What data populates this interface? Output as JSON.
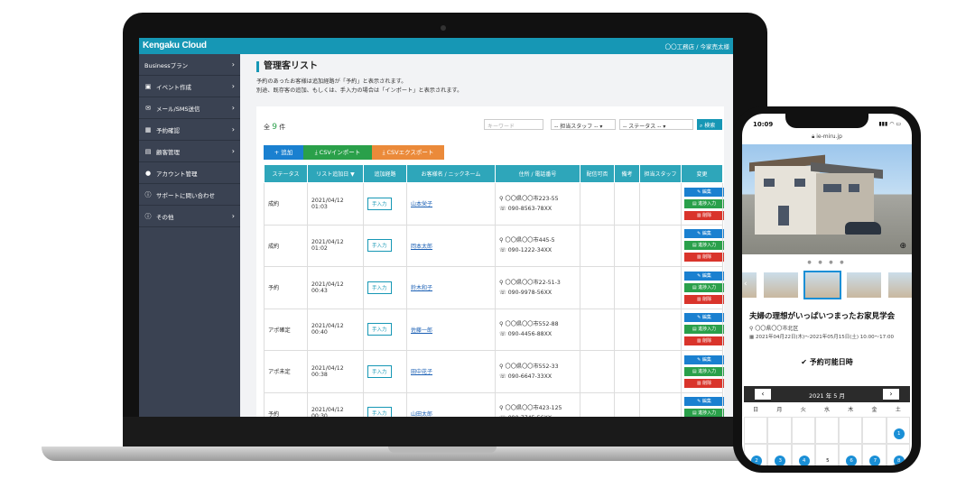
{
  "app": {
    "logo_a": "Kengaku",
    "logo_b": "Cloud",
    "user": "〇〇工務店 / 今家売太様"
  },
  "sidebar": [
    {
      "label": "Businessプラン",
      "icon": "none"
    },
    {
      "label": "イベント作成",
      "icon": "image-icon"
    },
    {
      "label": "メール/SMS送信",
      "icon": "mail-icon"
    },
    {
      "label": "予約確認",
      "icon": "calendar-icon"
    },
    {
      "label": "顧客管理",
      "icon": "id-card-icon"
    },
    {
      "label": "アカウント管理",
      "icon": "user-icon"
    },
    {
      "label": "サポートに問い合わせ",
      "icon": "info-icon"
    },
    {
      "label": "その他",
      "icon": "info-icon"
    }
  ],
  "page": {
    "title": "管理客リスト",
    "desc1": "予約のあったお客様は追加経路が「予約」と表示されます。",
    "desc2": "別途、既存客の追加、もしくは、手入力の場合は「インポート」と表示されます。"
  },
  "list": {
    "count_prefix": "全",
    "count": "9",
    "count_suffix": "件",
    "keyword_placeholder": "キーワード",
    "staff_select": "-- 担当スタッフ --",
    "status_select": "-- ステータス --",
    "search": "検索"
  },
  "actions": {
    "add": "追加",
    "csv_import": "CSVインポート",
    "csv_export": "CSVエクスポート"
  },
  "table": {
    "headers": [
      "ステータス",
      "リスト追加日 ▼",
      "追加経路",
      "お客様名 / ニックネーム",
      "住所 / 電話番号",
      "配信可否",
      "備考",
      "担当スタッフ",
      "変更"
    ],
    "rows": [
      {
        "status": "成約",
        "date": "2021/04/12",
        "time": "01:03",
        "route": "手入力",
        "name": "山本栄子",
        "addr": "〇〇県〇〇市223-55",
        "tel": "090-8563-78XX"
      },
      {
        "status": "成約",
        "date": "2021/04/12",
        "time": "01:02",
        "route": "手入力",
        "name": "岡本太郎",
        "addr": "〇〇県〇〇市445-5",
        "tel": "090-1222-34XX"
      },
      {
        "status": "予約",
        "date": "2021/04/12",
        "time": "00:43",
        "route": "手入力",
        "name": "鈴木和子",
        "addr": "〇〇県〇〇市22-51-3",
        "tel": "090-9978-56XX"
      },
      {
        "status": "アポ確定",
        "date": "2021/04/12",
        "time": "00:40",
        "route": "手入力",
        "name": "佐藤一郎",
        "addr": "〇〇県〇〇市552-88",
        "tel": "090-4456-88XX"
      },
      {
        "status": "アポ未定",
        "date": "2021/04/12",
        "time": "00:38",
        "route": "手入力",
        "name": "田中花子",
        "addr": "〇〇県〇〇市552-33",
        "tel": "090-6647-33XX"
      },
      {
        "status": "予約",
        "date": "2021/04/12",
        "time": "00:30",
        "route": "手入力",
        "name": "山田太郎",
        "addr": "〇〇県〇〇市423-125",
        "tel": "090-7745-56XX"
      }
    ],
    "ops": {
      "edit": "編集",
      "progress": "進捗入力",
      "delete": "削除"
    }
  },
  "phone": {
    "time": "10:09",
    "status": "▮▮▮ ◠ ▭",
    "url": "ie-miru.jp",
    "title": "夫婦の理想がいっぱいつまったお家見学会",
    "location": "〇〇県〇〇市北区",
    "dates": "2021年04月22日(木)〜2021年05月15日(土) 10:00〜17:00",
    "reserve": "予約可能日時",
    "cal_title": "2021 年 5 月",
    "weekdays": [
      "日",
      "月",
      "火",
      "水",
      "木",
      "金",
      "土"
    ],
    "row1_sat": "1",
    "row2": [
      "2",
      "3",
      "4",
      "5",
      "6",
      "7",
      "8"
    ]
  }
}
